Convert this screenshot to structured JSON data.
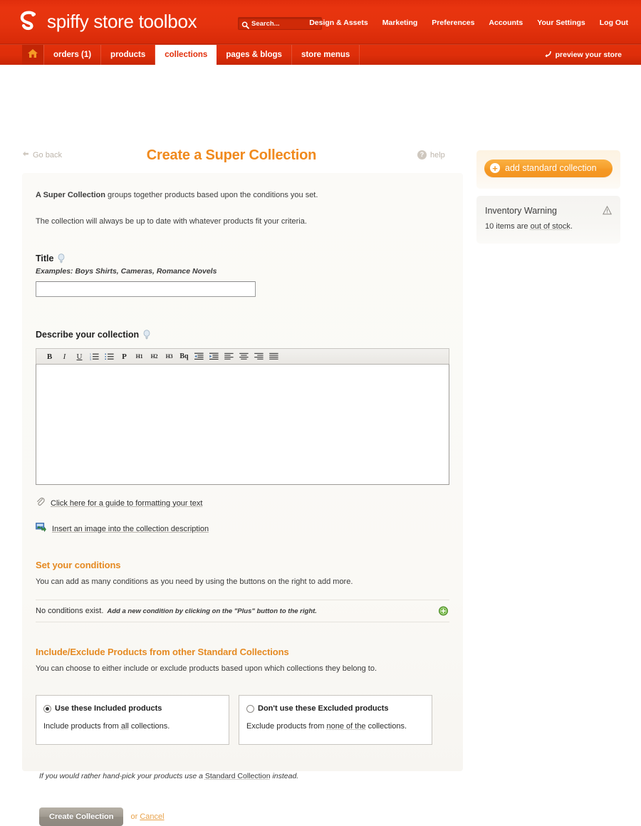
{
  "header": {
    "brand": "spiffy store toolbox",
    "logo_icon": "spiffy-s-logo",
    "search": {
      "icon": "search-icon",
      "placeholder": "Search...",
      "value": ""
    },
    "nav": [
      {
        "label": "Design & Assets"
      },
      {
        "label": "Marketing"
      },
      {
        "label": "Preferences"
      },
      {
        "label": "Accounts"
      },
      {
        "label": "Your Settings"
      },
      {
        "label": "Log Out"
      }
    ]
  },
  "tabs": {
    "home_icon": "home-icon",
    "items": [
      {
        "label": "orders (1)",
        "active": false
      },
      {
        "label": "products",
        "active": false
      },
      {
        "label": "collections",
        "active": true
      },
      {
        "label": "pages & blogs",
        "active": false
      },
      {
        "label": "store menus",
        "active": false
      }
    ],
    "preview": {
      "label": "preview your store",
      "icon": "arrow-curve-icon"
    }
  },
  "page": {
    "go_back": "Go back",
    "go_back_icon": "arrow-left-icon",
    "title": "Create a Super Collection",
    "help": "help",
    "help_icon": "question-mark-icon"
  },
  "intro": {
    "line1_strong": "A Super Collection",
    "line1_rest": " groups together products based upon the conditions you set.",
    "line2": "The collection will always be up to date with whatever products fit your criteria."
  },
  "title_field": {
    "label": "Title",
    "hint_icon": "lightbulb-icon",
    "examples": "Examples: Boys Shirts, Cameras, Romance Novels",
    "value": "",
    "placeholder": ""
  },
  "description_field": {
    "label": "Describe your collection",
    "hint_icon": "lightbulb-icon",
    "value": "",
    "toolbar": [
      {
        "name": "bold",
        "glyph": "B"
      },
      {
        "name": "italic",
        "glyph": "I"
      },
      {
        "name": "underline",
        "glyph": "U"
      },
      {
        "name": "ordered-list",
        "glyph": ""
      },
      {
        "name": "unordered-list",
        "glyph": ""
      },
      {
        "name": "paragraph",
        "glyph": "P"
      },
      {
        "name": "heading-1",
        "glyph": "H1"
      },
      {
        "name": "heading-2",
        "glyph": "H2"
      },
      {
        "name": "heading-3",
        "glyph": "H3"
      },
      {
        "name": "blockquote",
        "glyph": "Bq"
      },
      {
        "name": "outdent",
        "glyph": ""
      },
      {
        "name": "indent",
        "glyph": ""
      },
      {
        "name": "align-left",
        "glyph": ""
      },
      {
        "name": "align-center",
        "glyph": ""
      },
      {
        "name": "align-right",
        "glyph": ""
      },
      {
        "name": "align-justify",
        "glyph": ""
      }
    ]
  },
  "editor_links": [
    {
      "icon": "paperclip-icon",
      "label": "Click here for a guide to formatting your text"
    },
    {
      "icon": "insert-image-icon",
      "label": "Insert an image into the collection description"
    }
  ],
  "conditions": {
    "heading": "Set your conditions",
    "subtext": "You can add as many conditions as you need by using the buttons on the right to add more.",
    "empty_label": "No conditions exist.",
    "empty_hint": "Add a new condition by clicking on the \"Plus\" button to the right.",
    "add_icon": "plus-circle-green-icon"
  },
  "include_exclude": {
    "heading": "Include/Exclude Products from other Standard Collections",
    "subtext": "You can choose to either include or exclude products based upon which collections they belong to.",
    "options": [
      {
        "selected": true,
        "title": "Use these Included products",
        "desc_prefix": "Include products from ",
        "desc_link": "all",
        "desc_suffix": " collections."
      },
      {
        "selected": false,
        "title": "Don't use these Excluded products",
        "desc_prefix": "Exclude products from ",
        "desc_link": "none of the",
        "desc_suffix": " collections."
      }
    ]
  },
  "footnote": {
    "prefix": "If you would rather hand-pick your products use a ",
    "link": "Standard Collection",
    "suffix": " instead."
  },
  "actions": {
    "submit_label": "Create Collection",
    "or_label": "or ",
    "cancel_label": "Cancel"
  },
  "sidebar": {
    "add_button": {
      "label": "add standard collection",
      "icon": "plus-circle-icon"
    },
    "warning": {
      "title": "Inventory Warning",
      "icon": "warning-triangle-icon",
      "body_prefix": "10 items are ",
      "body_link": "out of stock",
      "body_suffix": "."
    }
  },
  "colors": {
    "brand_red": "#e2300b",
    "accent_orange": "#f08a1e",
    "button_orange": "#f59a26",
    "muted_grey": "#bdb5ab"
  }
}
